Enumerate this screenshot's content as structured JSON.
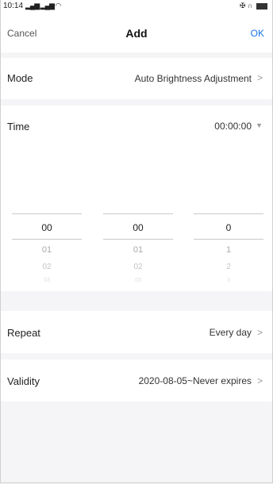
{
  "status_bar": {
    "time": "10:14",
    "signal": "▂▄▆ ▂▄▆ ◠",
    "right_icons": "✠ ∩"
  },
  "header": {
    "cancel": "Cancel",
    "title": "Add",
    "ok": "OK"
  },
  "mode": {
    "label": "Mode",
    "value": "Auto Brightness Adjustment"
  },
  "time_row": {
    "label": "Time",
    "value": "00:00:00"
  },
  "picker": {
    "hours": [
      "00",
      "01",
      "02",
      "03"
    ],
    "minutes": [
      "00",
      "01",
      "02",
      "03"
    ],
    "seconds": [
      "0",
      "1",
      "2",
      "3"
    ]
  },
  "repeat": {
    "label": "Repeat",
    "value": "Every day"
  },
  "validity": {
    "label": "Validity",
    "value": "2020-08-05~Never expires"
  },
  "colors": {
    "accent": "#1a73e8",
    "background": "#f5f5f7",
    "divider": "#c9c9c9"
  }
}
